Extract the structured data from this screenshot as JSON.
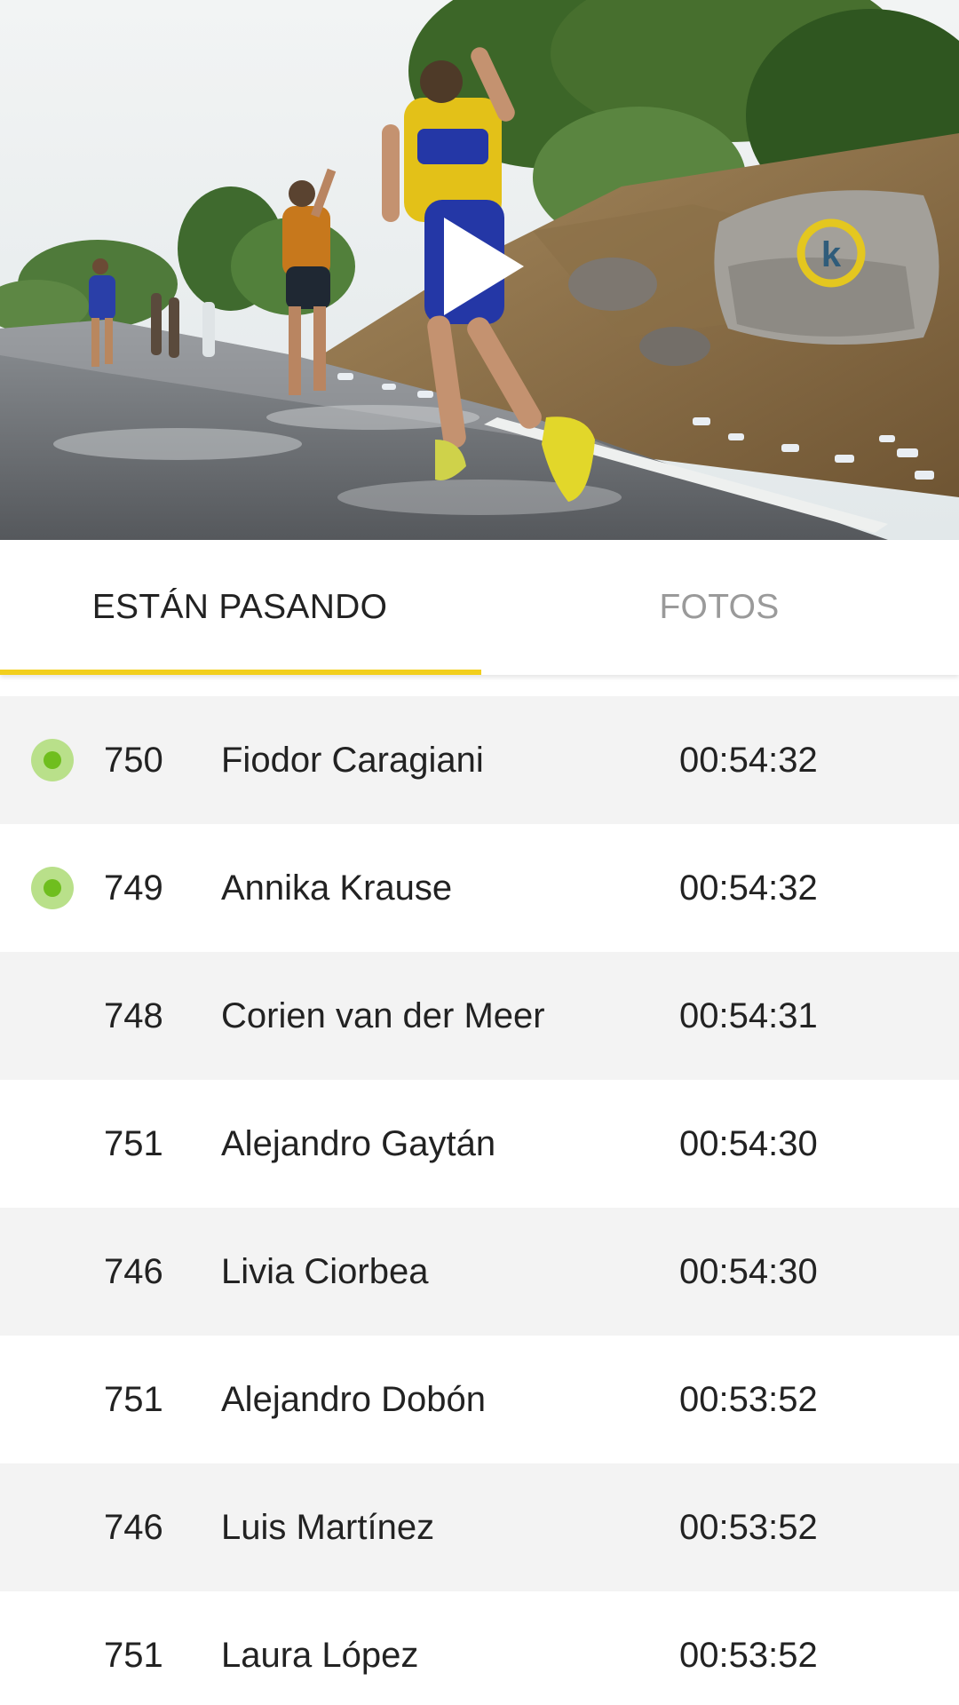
{
  "video": {
    "play_icon": "play-icon"
  },
  "tabs": [
    {
      "label": "ESTÁN PASANDO",
      "active": true
    },
    {
      "label": "FOTOS",
      "active": false
    }
  ],
  "colors": {
    "accent": "#f2cf1d",
    "live_dot": "#6fbe1e",
    "live_dot_halo": "#b9e08a",
    "inactive_tab": "#9a9a9a",
    "row_alt": "#f3f3f3"
  },
  "runners": [
    {
      "bib": "750",
      "name": "Fiodor Caragiani",
      "time": "00:54:32",
      "live": true
    },
    {
      "bib": "749",
      "name": "Annika Krause",
      "time": "00:54:32",
      "live": true
    },
    {
      "bib": "748",
      "name": "Corien van der Meer",
      "time": "00:54:31",
      "live": false
    },
    {
      "bib": "751",
      "name": "Alejandro Gaytán",
      "time": "00:54:30",
      "live": false
    },
    {
      "bib": "746",
      "name": "Livia Ciorbea",
      "time": "00:54:30",
      "live": false
    },
    {
      "bib": "751",
      "name": "Alejandro Dobón",
      "time": "00:53:52",
      "live": false
    },
    {
      "bib": "746",
      "name": "Luis Martínez",
      "time": "00:53:52",
      "live": false
    },
    {
      "bib": "751",
      "name": "Laura López",
      "time": "00:53:52",
      "live": false
    }
  ]
}
